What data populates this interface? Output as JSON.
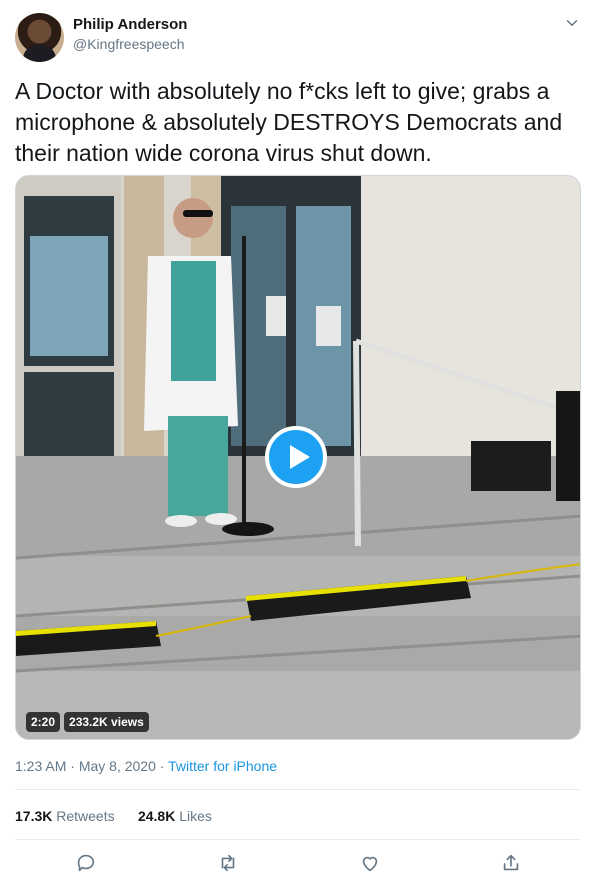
{
  "user": {
    "name": "Philip Anderson",
    "handle": "@Kingfreespeech"
  },
  "tweet": {
    "text": "A Doctor with absolutely no f*cks left to give; grabs a microphone & absolutely DESTROYS Democrats and their nation wide corona virus shut down."
  },
  "video": {
    "duration": "2:20",
    "views": "233.2K views"
  },
  "meta": {
    "time": "1:23 AM",
    "separator": "·",
    "date": "May 8, 2020",
    "source": "Twitter for iPhone"
  },
  "stats": {
    "retweets_count": "17.3K",
    "retweets_label": "Retweets",
    "likes_count": "24.8K",
    "likes_label": "Likes"
  },
  "icons": {
    "menu": "chevron-down-icon",
    "reply": "reply-icon",
    "retweet": "retweet-icon",
    "like": "heart-icon",
    "share": "share-icon",
    "play": "play-icon"
  },
  "colors": {
    "accent": "#1da1f2",
    "link": "#1b95e0",
    "text": "#14171a",
    "secondary": "#657786"
  }
}
